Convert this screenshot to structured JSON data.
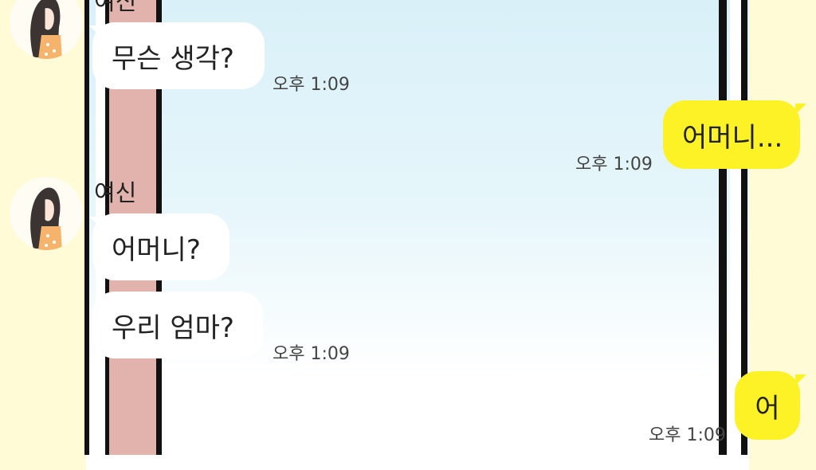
{
  "chat": {
    "messages": [
      {
        "sender": "여신",
        "text": "무슨 생각?",
        "time": "오후 1:09",
        "side": "left"
      },
      {
        "text": "어머니...",
        "time": "오후 1:09",
        "side": "right"
      },
      {
        "sender": "여신",
        "text": "어머니?",
        "side": "left"
      },
      {
        "text": "우리 엄마?",
        "time": "오후 1:09",
        "side": "left"
      },
      {
        "text": "어",
        "time": "오후 1:09",
        "side": "right"
      }
    ]
  },
  "colors": {
    "background": "#fefbd6",
    "incoming_bubble": "#ffffff",
    "outgoing_bubble": "#fdf226",
    "panel_sky": "#d9f0f8",
    "pink_wall": "#e2b3ad"
  },
  "icons": {
    "avatar": "girl-avatar-icon"
  }
}
